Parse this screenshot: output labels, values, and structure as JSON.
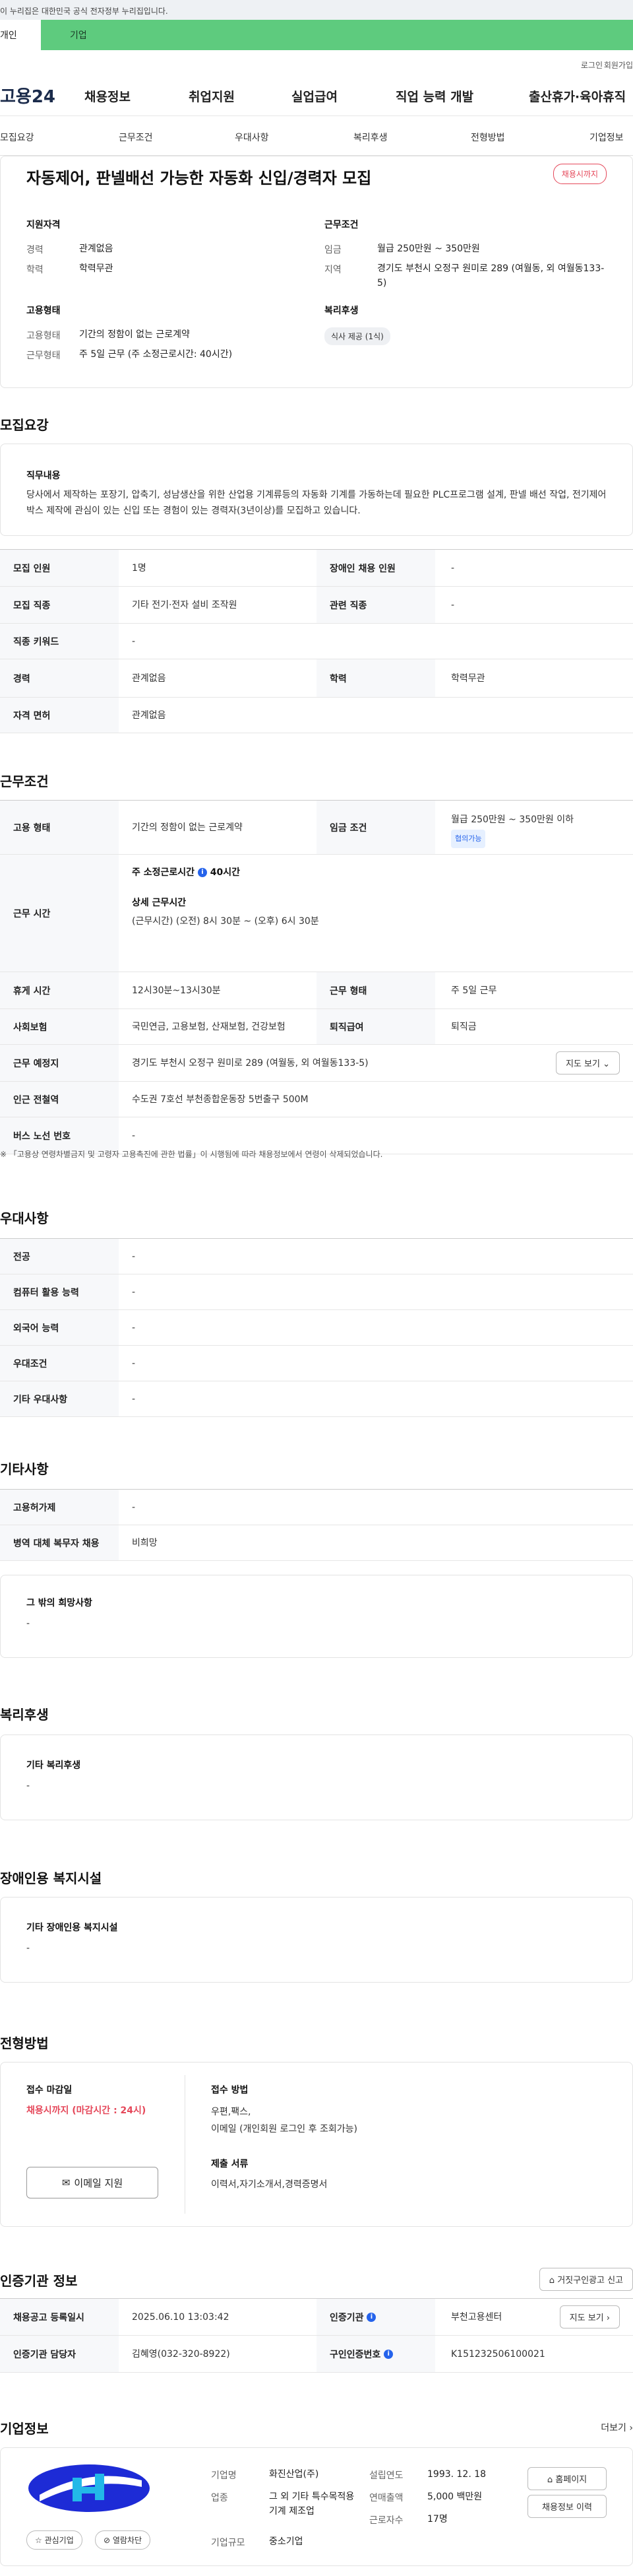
{
  "top_notice": "이 누리집은 대한민국 공식 전자정부 누리집입니다.",
  "tabs": {
    "personal": "개인",
    "company": "기업"
  },
  "util": {
    "login": "로그인",
    "join": "회원가입"
  },
  "logo": "고용24",
  "gnb": [
    "채용정보",
    "취업지원",
    "실업급여",
    "직업 능력 개발",
    "출산휴가·육아휴직"
  ],
  "subnav": [
    "모집요강",
    "근무조건",
    "우대사항",
    "복리후생",
    "전형방법",
    "기업정보"
  ],
  "summary": {
    "title": "자동제어, 판넬배선 가능한 자동화 신입/경력자 모집",
    "status": "채용시까지",
    "qual_heading": "지원자격",
    "career_label": "경력",
    "career_value": "관계없음",
    "edu_label": "학력",
    "edu_value": "학력무관",
    "emp_heading": "고용형태",
    "emp_label": "고용형태",
    "emp_value": "기간의 정함이 없는 근로계약",
    "work_label": "근무형태",
    "work_value": "주 5일 근무 (주 소정근로시간: 40시간)",
    "cond_heading": "근무조건",
    "wage_label": "임금",
    "wage_value": "월급 250만원 ~ 350만원",
    "region_label": "지역",
    "region_value": "경기도 부천시 오정구 원미로 289 (여월동, 외 여월동133-5)",
    "welfare_heading": "복리후생",
    "welfare_tag": "식사 제공 (1식)"
  },
  "recruit": {
    "title": "모집요강",
    "duty_heading": "직무내용",
    "duty_text": "당사에서 제작하는 포장기, 압축기, 성남생산을 위한 산업용 기계류등의 자동화 기계를 가동하는데 필요한 PLC프로그램 설계, 판넬 배선 작업, 전기제어박스 제작에 관심이 있는 신입 또는 경험이 있는 경력자(3년이상)를 모집하고 있습니다.",
    "rows": [
      {
        "l1": "모집 인원",
        "v1": "1명",
        "l2": "장애인 채용 인원",
        "v2": "-"
      },
      {
        "l1": "모집 직종",
        "v1": "기타 전기·전자 설비 조작원",
        "l2": "관련 직종",
        "v2": "-"
      },
      {
        "l1": "직종 키워드",
        "v1": "-"
      },
      {
        "l1": "경력",
        "v1": "관계없음",
        "l2": "학력",
        "v2": "학력무관"
      },
      {
        "l1": "자격 면허",
        "v1": "관계없음"
      }
    ]
  },
  "conditions": {
    "title": "근무조건",
    "emp_label": "고용 형태",
    "emp_value": "기간의 정함이 없는 근로계약",
    "wage_label": "임금 조건",
    "wage_value": "월급 250만원 ~ 350만원 이하",
    "wage_badge": "협의가능",
    "hours_label": "근무 시간",
    "hours_weekly": "주 소정근로시간 ",
    "hours_weekly_value": "40시간",
    "hours_detail_heading": "상세 근무시간",
    "hours_detail": "(근무시간) (오전) 8시 30분 ~ (오후) 6시 30분",
    "rest_label": "휴게 시간",
    "rest_value": "12시30분~13시30분",
    "form_label": "근무 형태",
    "form_value": "주 5일 근무",
    "ins_label": "사회보험",
    "ins_value": "국민연금, 고용보험, 산재보험, 건강보험",
    "sev_label": "퇴직급여",
    "sev_value": "퇴직금",
    "place_label": "근무 예정지",
    "place_value": "경기도 부천시 오정구 원미로 289 (여월동, 외 여월동133-5)",
    "map_btn": "지도 보기",
    "subway_label": "인근 전철역",
    "subway_value": "수도권 7호선 부천종합운동장 5번출구 500M",
    "bus_label": "버스 노선 번호",
    "bus_value": "-",
    "note": "※ 「고용상 연령차별금지 및 고령자 고용촉진에 관한 법률」이 시행됨에 따라 채용정보에서 연령이 삭제되었습니다."
  },
  "pref": {
    "title": "우대사항",
    "rows": [
      {
        "l": "전공",
        "v": "-"
      },
      {
        "l": "컴퓨터 활용 능력",
        "v": "-"
      },
      {
        "l": "외국어 능력",
        "v": "-"
      },
      {
        "l": "우대조건",
        "v": "-"
      },
      {
        "l": "기타 우대사항",
        "v": "-"
      }
    ]
  },
  "etc": {
    "title": "기타사항",
    "rows": [
      {
        "l": "고용허가제",
        "v": "-"
      },
      {
        "l": "병역 대체 복무자 채용",
        "v": "비희망"
      }
    ],
    "other_heading": "그 밖의 희망사항",
    "other_value": "-"
  },
  "welfare": {
    "title": "복리후생",
    "heading": "기타 복리후생",
    "value": "-"
  },
  "disability": {
    "title": "장애인용 복지시설",
    "heading": "기타 장애인용 복지시설",
    "value": "-"
  },
  "selection": {
    "title": "전형방법",
    "deadline_heading": "접수 마감일",
    "deadline_value": "채용시까지 (마감시간 : 24시)",
    "method_heading": "접수 방법",
    "method_value1": "우편,팩스,",
    "method_value2": "이메일 (개인회원 로그인 후 조회가능)",
    "docs_heading": "제출 서류",
    "docs_value": "이력서,자기소개서,경력증명서",
    "email_btn": "이메일 지원"
  },
  "cert": {
    "title": "인증기관 정보",
    "report_btn": "거짓구인광고 신고",
    "reg_label": "채용공고 등록일시",
    "reg_value": "2025.06.10 13:03:42",
    "org_label": "인증기관",
    "org_value": "부천고용센터",
    "map_btn": "지도 보기",
    "mgr_label": "인증기관 담당자",
    "mgr_value": "김혜영(032-320-8922)",
    "no_label": "구인인증번호",
    "no_value": "K151232506100021"
  },
  "company": {
    "title": "기업정보",
    "more": "더보기",
    "name_label": "기업명",
    "name_value": "화진산업(주)",
    "year_label": "설립연도",
    "year_value": "1993. 12. 18",
    "biz_label": "업종",
    "biz_value": "그 외 기타 특수목적용 기계 제조업",
    "sales_label": "연매출액",
    "sales_value": "5,000 백만원",
    "scale_label": "기업규모",
    "scale_value": "중소기업",
    "emp_label": "근로자수",
    "emp_value": "17명",
    "homepage_btn": "홈페이지",
    "jobs_btn": "채용정보 이력",
    "fav_btn": "관심기업",
    "block_btn": "열람차단"
  },
  "colors": {
    "brand_green": "#5ecb7e",
    "accent_red": "#e5485a",
    "accent_blue": "#2563eb"
  }
}
